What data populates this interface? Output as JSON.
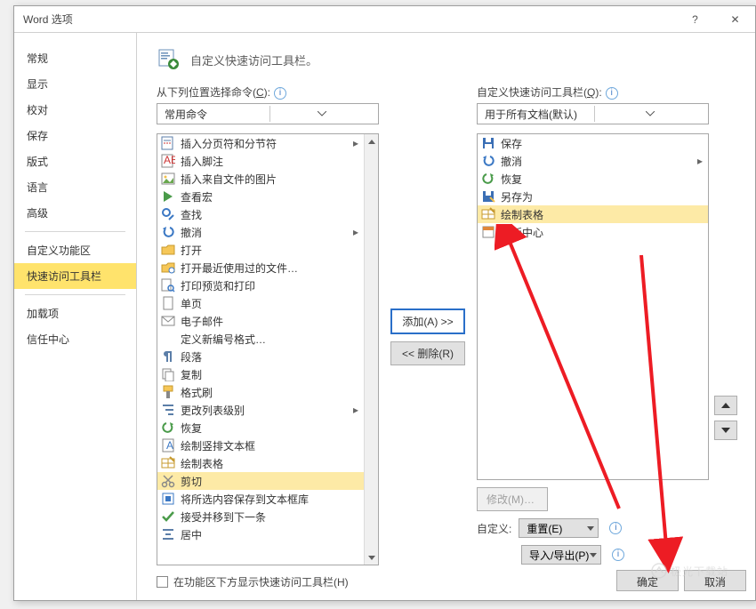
{
  "window": {
    "title": "Word 选项",
    "help": "?",
    "close": "✕"
  },
  "nav": {
    "items": [
      "常规",
      "显示",
      "校对",
      "保存",
      "版式",
      "语言",
      "高级"
    ],
    "items2": [
      "自定义功能区",
      "快速访问工具栏"
    ],
    "items3": [
      "加载项",
      "信任中心"
    ],
    "selected": "快速访问工具栏"
  },
  "header": "自定义快速访问工具栏。",
  "left": {
    "label_pre": "从下列位置选择命令(",
    "label_u": "C",
    "label_post": "):",
    "dropdown": "常用命令",
    "items": [
      {
        "icon": "page-break",
        "text": "插入分页符和分节符",
        "arrow": true
      },
      {
        "icon": "footnote",
        "text": "插入脚注"
      },
      {
        "icon": "picture",
        "text": "插入来自文件的图片"
      },
      {
        "icon": "play",
        "text": "查看宏"
      },
      {
        "icon": "find",
        "text": "查找"
      },
      {
        "icon": "undo",
        "text": "撤消",
        "arrow": true
      },
      {
        "icon": "open",
        "text": "打开"
      },
      {
        "icon": "recent",
        "text": "打开最近使用过的文件…"
      },
      {
        "icon": "preview",
        "text": "打印预览和打印"
      },
      {
        "icon": "onepage",
        "text": "单页"
      },
      {
        "icon": "email",
        "text": "电子邮件"
      },
      {
        "icon": "blank",
        "text": "定义新编号格式…"
      },
      {
        "icon": "paragraph",
        "text": "段落"
      },
      {
        "icon": "copy",
        "text": "复制"
      },
      {
        "icon": "formatpainter",
        "text": "格式刷"
      },
      {
        "icon": "listlevel",
        "text": "更改列表级别",
        "arrow": true
      },
      {
        "icon": "redo",
        "text": "恢复"
      },
      {
        "icon": "verttext",
        "text": "绘制竖排文本框"
      },
      {
        "icon": "drawtable",
        "text": "绘制表格"
      },
      {
        "icon": "cut",
        "text": "剪切",
        "sel": true
      },
      {
        "icon": "savesel",
        "text": "将所选内容保存到文本框库"
      },
      {
        "icon": "accept",
        "text": "接受并移到下一条"
      },
      {
        "icon": "center",
        "text": "居中"
      }
    ]
  },
  "right": {
    "label_pre": "自定义快速访问工具栏(",
    "label_u": "Q",
    "label_post": "):",
    "dropdown": "用于所有文档(默认)",
    "items": [
      {
        "icon": "save",
        "text": "保存"
      },
      {
        "icon": "undo",
        "text": "撤消",
        "arrow": true
      },
      {
        "icon": "redo",
        "text": "恢复"
      },
      {
        "icon": "saveas",
        "text": "另存为"
      },
      {
        "icon": "drawtable",
        "text": "绘制表格",
        "sel": true
      },
      {
        "icon": "template",
        "text": "模板中心"
      }
    ]
  },
  "mid": {
    "add": "添加(A) >>",
    "remove": "<< 删除(R)"
  },
  "modify": "修改(M)…",
  "reset_label": "自定义:",
  "reset": "重置(E)",
  "importexport": "导入/导出(P)",
  "checkbox": "在功能区下方显示快速访问工具栏(H)",
  "footer": {
    "ok": "确定",
    "cancel": "取消"
  },
  "watermark": "极光下载站"
}
